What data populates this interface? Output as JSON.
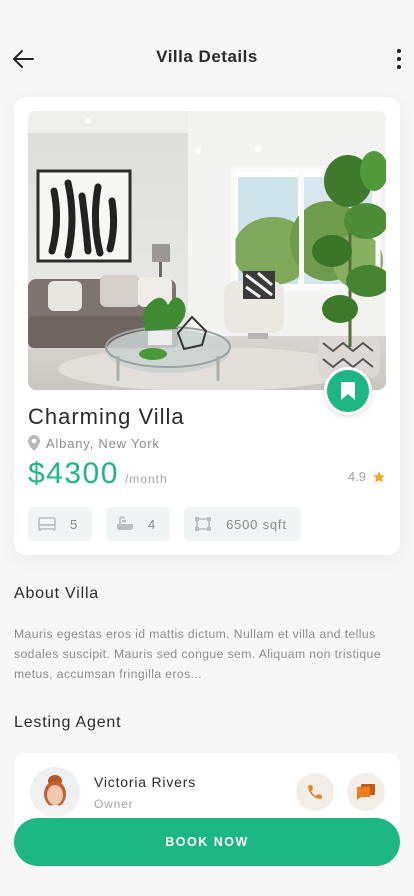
{
  "header": {
    "title": "Villa Details",
    "back_icon": "arrow-left-icon",
    "more_icon": "more-vertical-icon"
  },
  "property": {
    "name": "Charming Villa",
    "location": "Albany, New York",
    "price": "$4300",
    "price_unit": "/month",
    "rating": "4.9",
    "features": [
      {
        "icon": "bed-icon",
        "value": "5"
      },
      {
        "icon": "bathtub-icon",
        "value": "4"
      },
      {
        "icon": "area-icon",
        "value": "6500 sqft"
      }
    ]
  },
  "about": {
    "title": "About Villa",
    "text": "Mauris egestas eros id mattis dictum. Nullam et villa and tellus sodales suscipit. Mauris sed congue sem. Aliquam non tristique metus, accumsan fringilla eros..."
  },
  "agent": {
    "section_title": "Lesting Agent",
    "name": "Victoria Rivers",
    "role": "Owner"
  },
  "actions": {
    "book_label": "BOOK NOW"
  },
  "colors": {
    "accent": "#1db784",
    "star": "#f5a623",
    "agent_action": "#f07c1b",
    "background": "#f7f7f7"
  }
}
